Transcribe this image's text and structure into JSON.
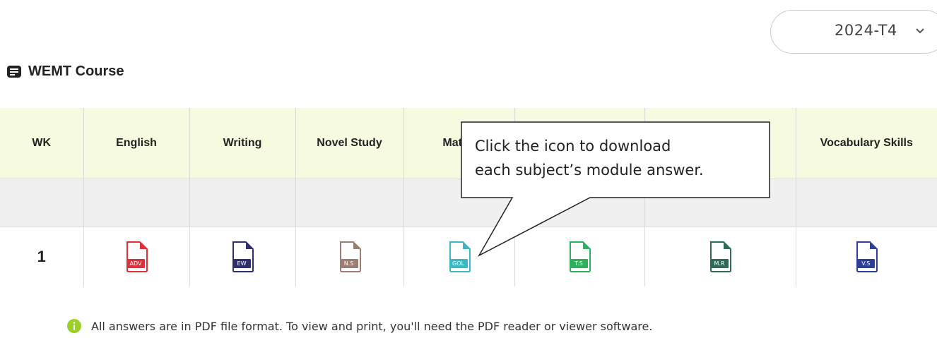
{
  "term_select": {
    "value": "2024-T4"
  },
  "course": {
    "title": "WEMT Course"
  },
  "table": {
    "headers": [
      "WK",
      "English",
      "Writing",
      "Novel Study",
      "Mathe",
      "",
      "",
      "Vocabulary Skills"
    ],
    "weeks": [
      {
        "wk": "1",
        "files": [
          {
            "badge": "ADV",
            "color": "#e0303a"
          },
          {
            "badge": "EW",
            "color": "#2e2f6e"
          },
          {
            "badge": "N.S",
            "color": "#9c7f72"
          },
          {
            "badge": "GOL",
            "color": "#3bb8c4"
          },
          {
            "badge": "T.S",
            "color": "#2db15a"
          },
          {
            "badge": "M.R",
            "color": "#2f6b5a"
          },
          {
            "badge": "V.S",
            "color": "#2d3f98"
          }
        ]
      }
    ]
  },
  "tooltip": {
    "line1": "Click the icon to download",
    "line2": "each subject’s module answer."
  },
  "notice": {
    "text": "All answers are in PDF file format. To view and print, you'll need the PDF reader or viewer software."
  },
  "icons": {
    "select": "chevron-down-icon",
    "title": "list-icon",
    "file": "pdf-file-icon",
    "notice": "info-icon"
  },
  "colors": {
    "header_bg": "#f6fbdf",
    "spacer_bg": "#f0f0f0",
    "info": "#9ccf2a"
  }
}
